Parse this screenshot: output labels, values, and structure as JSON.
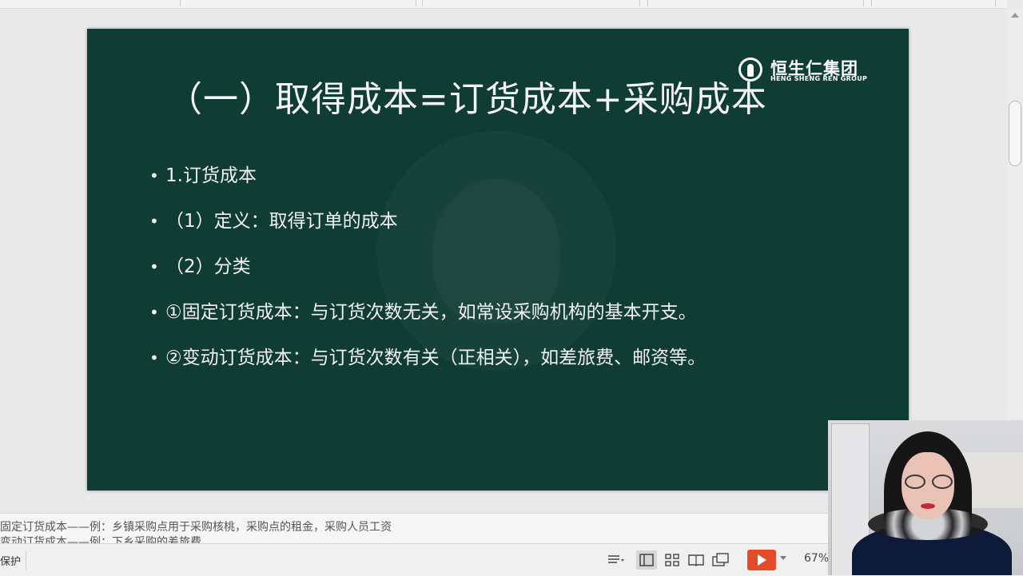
{
  "slide": {
    "title": "（一）取得成本=订货成本+采购成本",
    "logo": {
      "name": "恒生仁集团",
      "english": "HENG SHENG REN GROUP"
    },
    "bullets": [
      "1.订货成本",
      "（1）定义：取得订单的成本",
      "（2）分类",
      "①固定订货成本：与订货次数无关，如常设采购机构的基本开支。",
      "②变动订货成本：与订货次数有关（正相关），如差旅费、邮资等。"
    ]
  },
  "notes": {
    "line1": "固定订货成本——例：乡镇采购点用于采购核桃，采购点的租金，采购人员工资",
    "line2": "变动订货成本——例：下乡采购的差旅费"
  },
  "statusbar": {
    "left_text": "保护",
    "zoom": "67%",
    "icons": [
      "notes-toggle-icon",
      "normal-view-icon",
      "slide-sorter-icon",
      "reading-view-icon",
      "presenter-view-icon",
      "play-icon"
    ]
  },
  "colors": {
    "slide_bg": "#0f3c33",
    "play_button": "#e44b2a"
  }
}
